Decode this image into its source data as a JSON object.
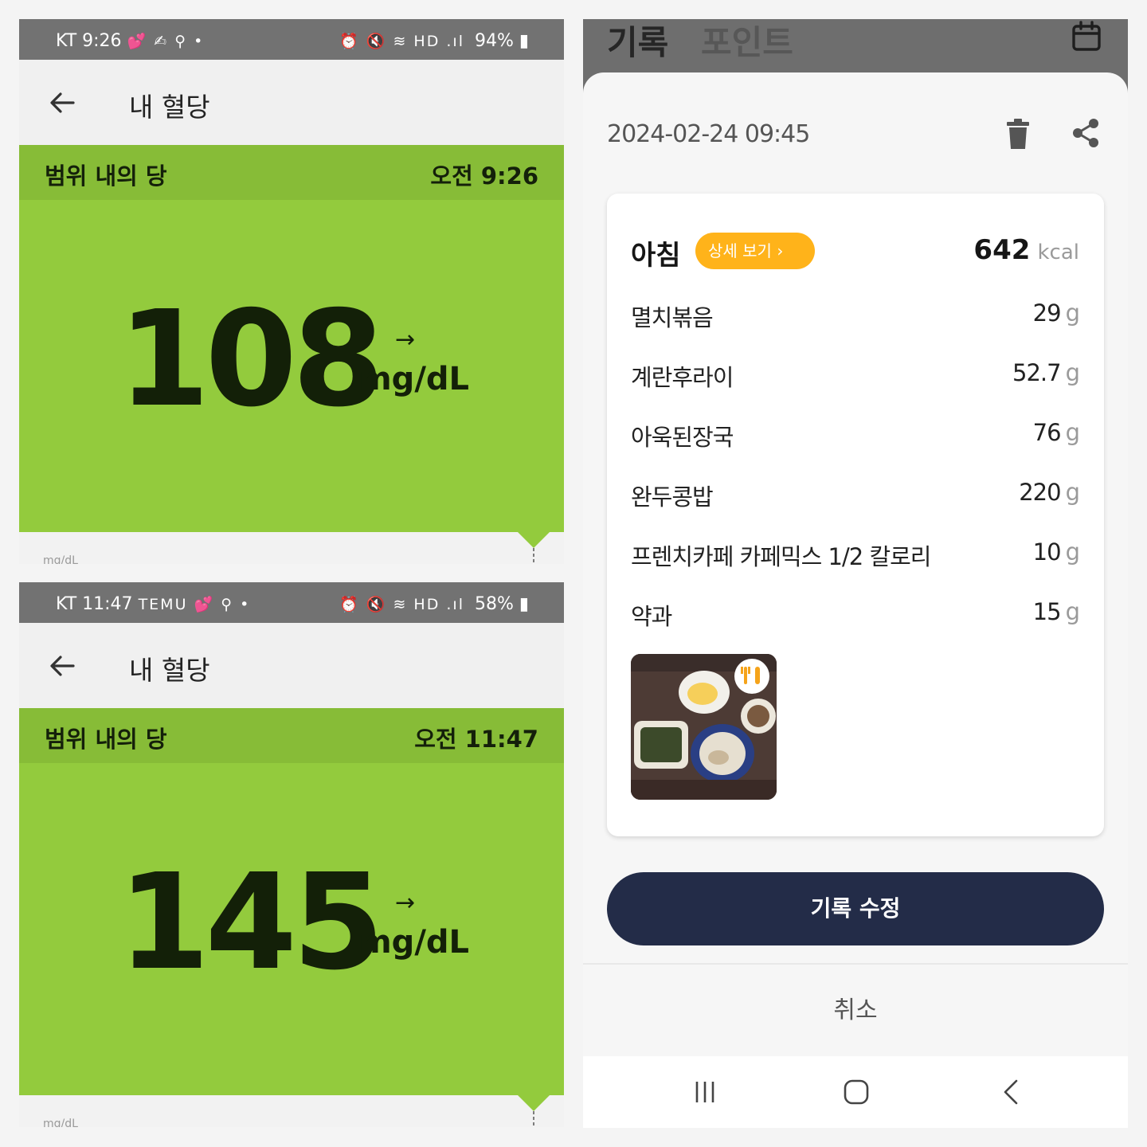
{
  "panels": [
    {
      "status": {
        "left": "KT 9:26",
        "left_icons": "💕 ✍ ⚲ •",
        "right_icons": "⏰ 🔇 ≋ HD .ıl",
        "battery": "94%"
      },
      "app_title": "내 혈당",
      "range_label": "범위 내의 당",
      "time": "오전 9:26",
      "value": "108",
      "trend": "→",
      "unit": "mg/dL",
      "chart_axis_label": "mg/dL"
    },
    {
      "status": {
        "left": "KT 11:47",
        "left_icons": "TEMU 💕 ⚲ •",
        "right_icons": "⏰ 🔇 ≋ HD .ıl",
        "battery": "58%"
      },
      "app_title": "내 혈당",
      "range_label": "범위 내의 당",
      "time": "오전 11:47",
      "value": "145",
      "trend": "→",
      "unit": "mg/dL",
      "chart_axis_label": "mg/dL"
    }
  ],
  "meal_screen": {
    "tabs": [
      "기록",
      "포인트"
    ],
    "datetime": "2024-02-24 09:45",
    "meal": {
      "name": "아침",
      "detail_button": "상세 보기 ›",
      "kcal_value": "642",
      "kcal_unit": "kcal",
      "foods": [
        {
          "name": "멸치볶음",
          "amount": "29",
          "unit": "g"
        },
        {
          "name": "계란후라이",
          "amount": "52.7",
          "unit": "g"
        },
        {
          "name": "아욱된장국",
          "amount": "76",
          "unit": "g"
        },
        {
          "name": "완두콩밥",
          "amount": "220",
          "unit": "g"
        },
        {
          "name": "프렌치카페 카페믹스 1/2 칼로리",
          "amount": "10",
          "unit": "g"
        },
        {
          "name": "약과",
          "amount": "15",
          "unit": "g"
        }
      ]
    },
    "edit_button": "기록 수정",
    "cancel_button": "취소"
  },
  "colors": {
    "in_range_bar": "#87bc37",
    "reading_bg": "#93cb3d",
    "accent_orange": "#ffb31a",
    "primary_navy": "#232c48"
  },
  "icons": {
    "back": "arrow-left-icon",
    "calendar": "calendar-icon",
    "trash": "trash-icon",
    "share": "share-icon",
    "utensils": "utensils-icon",
    "nav_recent": "recent-apps-icon",
    "nav_home": "home-icon",
    "nav_back": "chevron-left-icon"
  }
}
